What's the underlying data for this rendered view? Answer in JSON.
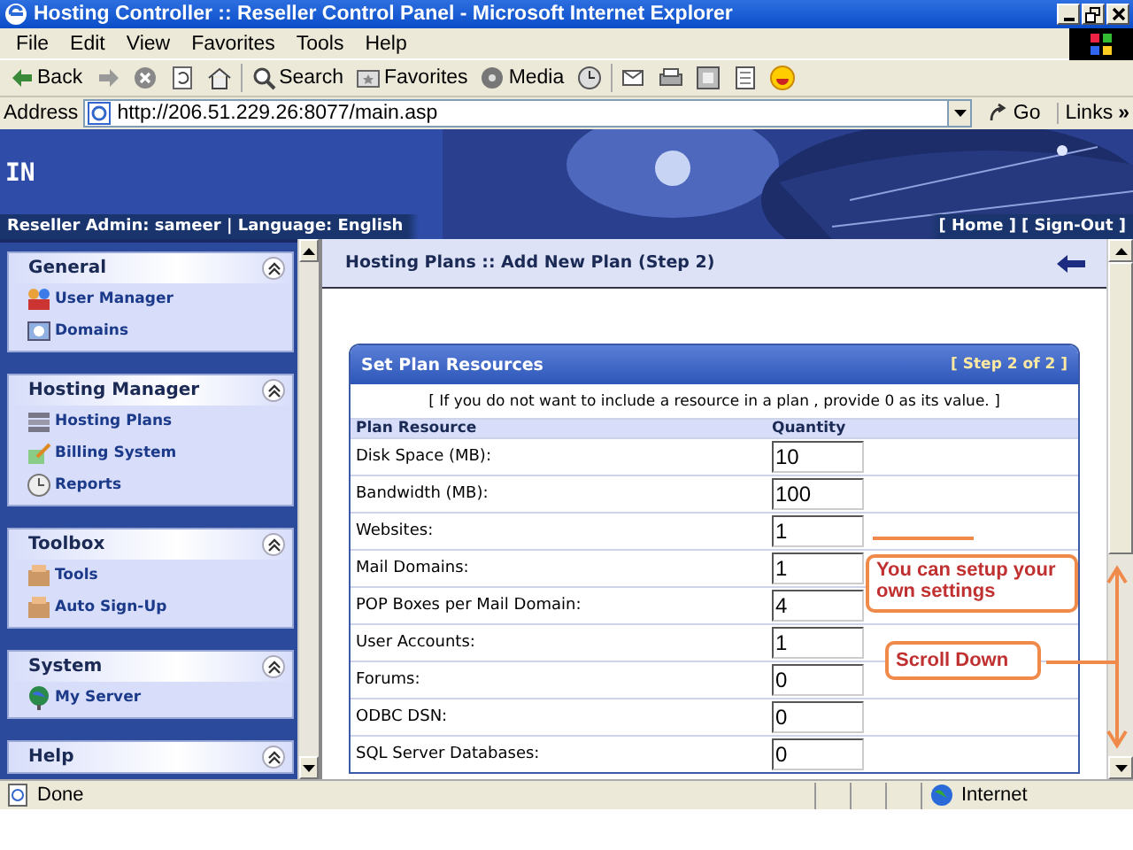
{
  "window": {
    "title": "Hosting Controller :: Reseller Control Panel - Microsoft Internet Explorer"
  },
  "menu": [
    "File",
    "Edit",
    "View",
    "Favorites",
    "Tools",
    "Help"
  ],
  "toolbar": [
    {
      "kind": "back",
      "label": "Back"
    },
    {
      "kind": "forward"
    },
    {
      "kind": "stop"
    },
    {
      "kind": "refresh"
    },
    {
      "kind": "home"
    },
    {
      "kind": "search",
      "label": "Search"
    },
    {
      "kind": "favorites",
      "label": "Favorites"
    },
    {
      "kind": "media",
      "label": "Media"
    },
    {
      "kind": "history"
    },
    {
      "kind": "mail"
    },
    {
      "kind": "print"
    },
    {
      "kind": "edit"
    },
    {
      "kind": "discuss"
    },
    {
      "kind": "messenger"
    }
  ],
  "address": {
    "label": "Address",
    "url": "http://206.51.229.26:8077/main.asp",
    "go": "Go",
    "links": "Links",
    "more": "»"
  },
  "banner": {
    "logo_text": "IN",
    "user_info": "Reseller Admin: sameer | Language: English",
    "links": [
      "[ Home ]",
      "[ Sign-Out ]"
    ]
  },
  "sidebar": {
    "sections": [
      {
        "title": "General",
        "expanded": true,
        "items": [
          {
            "label": "User Manager",
            "kind": "users"
          },
          {
            "label": "Domains",
            "kind": "globe"
          }
        ]
      },
      {
        "title": "Hosting Manager",
        "expanded": true,
        "items": [
          {
            "label": "Hosting Plans",
            "kind": "stack"
          },
          {
            "label": "Billing System",
            "kind": "pencil"
          },
          {
            "label": "Reports",
            "kind": "clock"
          }
        ]
      },
      {
        "title": "Toolbox",
        "expanded": true,
        "items": [
          {
            "label": "Tools",
            "kind": "box"
          },
          {
            "label": "Auto Sign-Up",
            "kind": "box"
          }
        ]
      },
      {
        "title": "System",
        "expanded": true,
        "items": [
          {
            "label": "My Server",
            "kind": "earth"
          }
        ]
      },
      {
        "title": "Help",
        "expanded": true
      }
    ]
  },
  "page_header": {
    "title": "Hosting Plans :: Add New Plan (Step 2)"
  },
  "panel": {
    "title": "Set Plan Resources",
    "step": "[ Step 2 of 2 ]",
    "note": "[ If you do not want to include a resource in a plan , provide 0 as its value. ]",
    "columns": [
      "Plan Resource",
      "Quantity"
    ],
    "rows": [
      {
        "resource": "Disk Space (MB):",
        "value": "10"
      },
      {
        "resource": "Bandwidth (MB):",
        "value": "100"
      },
      {
        "resource": "Websites:",
        "value": "1"
      },
      {
        "resource": "Mail Domains:",
        "value": "1"
      },
      {
        "resource": "POP Boxes per Mail Domain:",
        "value": "4"
      },
      {
        "resource": "User Accounts:",
        "value": "1"
      },
      {
        "resource": "Forums:",
        "value": "0"
      },
      {
        "resource": "ODBC DSN:",
        "value": "0"
      },
      {
        "resource": "SQL Server Databases:",
        "value": "0"
      }
    ]
  },
  "annotations": [
    {
      "text": "You can setup your own settings"
    },
    {
      "text": "Scroll Down"
    }
  ],
  "status_bar": {
    "text": "Done",
    "zone": "Internet"
  }
}
